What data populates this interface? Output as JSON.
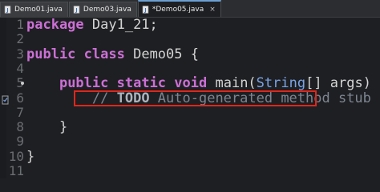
{
  "tabs": [
    {
      "label": "Demo01.java",
      "active": false
    },
    {
      "label": "Demo03.java",
      "active": false
    },
    {
      "label": "*Demo05.java",
      "active": true
    }
  ],
  "tab_close_glyph": "×",
  "editor": {
    "lines": [
      {
        "number": "1",
        "tokens": [
          [
            "kw",
            "package"
          ],
          [
            "plain",
            " Day1_21;"
          ]
        ]
      },
      {
        "number": "2",
        "tokens": []
      },
      {
        "number": "3",
        "tokens": [
          [
            "kw",
            "public"
          ],
          [
            "plain",
            " "
          ],
          [
            "kw",
            "class"
          ],
          [
            "plain",
            " Demo05 {"
          ]
        ]
      },
      {
        "number": "4",
        "tokens": []
      },
      {
        "number": "5",
        "tokens": [
          [
            "plain",
            "    "
          ],
          [
            "kw",
            "public"
          ],
          [
            "plain",
            " "
          ],
          [
            "kw",
            "static"
          ],
          [
            "plain",
            " "
          ],
          [
            "kw",
            "void"
          ],
          [
            "plain",
            " main("
          ],
          [
            "type",
            "String"
          ],
          [
            "plain",
            "[] args) {"
          ]
        ]
      },
      {
        "number": "6",
        "tokens": [
          [
            "plain",
            "        "
          ],
          [
            "comment",
            "// "
          ],
          [
            "todo",
            "TODO"
          ],
          [
            "comment",
            " Auto-generated method stub"
          ]
        ]
      },
      {
        "number": "7",
        "tokens": []
      },
      {
        "number": "8",
        "tokens": [
          [
            "plain",
            "    }"
          ]
        ]
      },
      {
        "number": "9",
        "tokens": []
      },
      {
        "number": "10",
        "tokens": [
          [
            "plain",
            "}"
          ]
        ]
      },
      {
        "number": "11",
        "tokens": []
      }
    ]
  },
  "colors": {
    "keyword": "#cc6fd6",
    "type": "#7aa3e6",
    "comment": "#7d8591",
    "highlight_box": "#e0261b"
  },
  "icons": {
    "tab_icon": "java-file-icon",
    "fold_marker": "fold-dot-icon",
    "task_marker": "todo-task-icon"
  }
}
